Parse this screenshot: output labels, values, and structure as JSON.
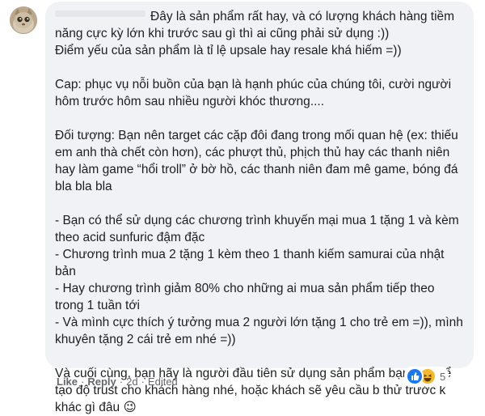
{
  "comment": {
    "text": "Đây là sản phẩm rất hay, và có lượng khách hàng tiềm năng cực kỳ lớn khi trước sau gì thì ai cũng phải sử dụng :))\nĐiểm yếu của sản phẩm là tỉ lệ upsale hay resale khá hiếm =))\n\nCap: phục vụ nỗi buồn của bạn là hạnh phúc của chúng tôi, cười người hôm trước hôm sau nhiều người khóc thương....\n\nĐối tượng: Bạn nên target các cặp đôi đang trong mối quan hệ (ex: thiếu em anh thà chết còn hơn), các phượt thủ, phịch thủ hay các thanh niên hay làm game “hổi troll” ở bờ hồ, các thanh niên đam mê game, bóng đá bla bla bla\n\n- Bạn có thể sử dụng các chương trình khuyến mại mua 1 tặng 1 và kèm theo acid sunfuric đậm đặc\n- Chương trình mua 2 tặng 1 kèm theo 1 thanh kiếm samurai của nhật bản\n- Hay chương trình giảm 80% cho những ai mua sản phẩm tiếp theo trong 1 tuần tới\n- Và mình cực thích ý tưởng mua 2 người lớn tặng 1 cho trẻ em =)), mình khuyên tặng 2 cái trẻ em nhé =))\n\nVà cuối cùng, bạn hãy là người đầu tiên sử dụng sản phẩm bạn bán để tạo độ trust cho khách hàng nhé, hoặc khách sẽ yêu cầu b thử trước k khác gì đâu",
    "emoji": "😉"
  },
  "actions": {
    "like": "Like",
    "reply": "Reply",
    "time": "2d",
    "edited": "Edited",
    "separator": "·"
  },
  "reactions": {
    "icons": [
      "like-icon",
      "haha-icon"
    ],
    "count": "5"
  },
  "colors": {
    "bubble": "#f0f2f5",
    "text": "#1c1e21",
    "meta": "#65676b",
    "like": "#1877f2",
    "haha": "#f7b928"
  }
}
